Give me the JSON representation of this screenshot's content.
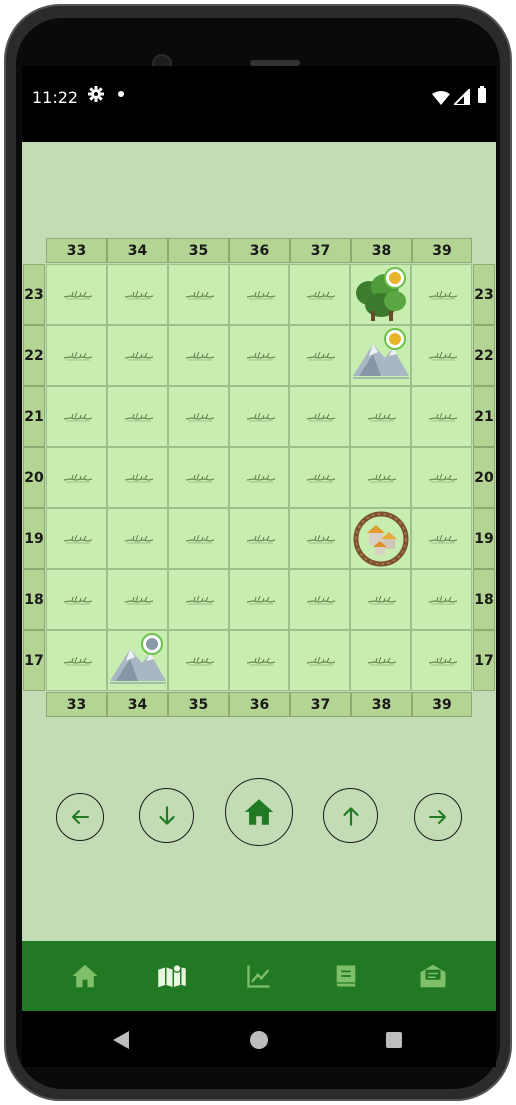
{
  "status_bar": {
    "time": "11:22",
    "icons": [
      "gear-icon",
      "notification-dot-icon",
      "wifi-icon",
      "signal-icon",
      "battery-icon"
    ]
  },
  "map": {
    "column_labels": [
      "33",
      "34",
      "35",
      "36",
      "37",
      "38",
      "39"
    ],
    "row_labels": [
      "23",
      "22",
      "21",
      "20",
      "19",
      "18",
      "17"
    ],
    "tiles": [
      {
        "row": "23",
        "col": "38",
        "type": "forest",
        "badge": "resource-badge-gold"
      },
      {
        "row": "22",
        "col": "38",
        "type": "mountain",
        "badge": "resource-badge-gold"
      },
      {
        "row": "19",
        "col": "38",
        "type": "settlement",
        "badge": ""
      },
      {
        "row": "17",
        "col": "34",
        "type": "mountain",
        "badge": "resource-badge-stone"
      }
    ],
    "default_tile": "grassland"
  },
  "controls": {
    "left": "arrow-left-icon",
    "down": "arrow-down-icon",
    "home": "home-icon",
    "up": "arrow-up-icon",
    "right": "arrow-right-icon"
  },
  "bottom_nav": {
    "tabs": [
      "home-icon",
      "map-icon",
      "stats-chart-icon",
      "book-icon",
      "mail-icon"
    ],
    "active": "map-icon"
  },
  "colors": {
    "app_background": "#c3dcb5",
    "tile_grass": "#c7eeb0",
    "header_cells": "#b4d494",
    "accent_green": "#217a23"
  }
}
